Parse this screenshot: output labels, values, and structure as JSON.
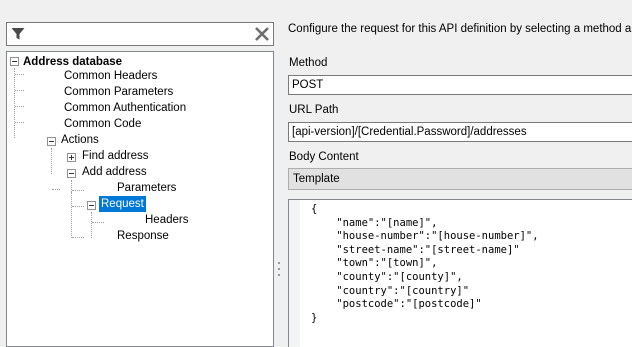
{
  "filter": {
    "value": ""
  },
  "tree": {
    "root": "Address database",
    "common_headers": "Common Headers",
    "common_parameters": "Common Parameters",
    "common_authentication": "Common Authentication",
    "common_code": "Common Code",
    "actions": "Actions",
    "find_address": "Find address",
    "add_address": "Add address",
    "parameters": "Parameters",
    "request": "Request",
    "headers": "Headers",
    "response": "Response"
  },
  "details": {
    "description": "Configure the request for this API definition by selecting a method a",
    "method_label": "Method",
    "method_value": "POST",
    "url_label": "URL Path",
    "url_value": "[api-version]/[Credential.Password]/addresses",
    "body_label": "Body Content",
    "body_type": "Template",
    "body_text": "{\n    \"name\":\"[name]\",\n    \"house-number\":\"[house-number]\",\n    \"street-name\":\"[street-name]\"\n    \"town\":\"[town]\",\n    \"county\":\"[county]\",\n    \"country\":\"[country]\"\n    \"postcode\":\"[postcode]\"\n}"
  },
  "colors": {
    "selection": "#0078d7",
    "panel": "#f0f0f0"
  }
}
